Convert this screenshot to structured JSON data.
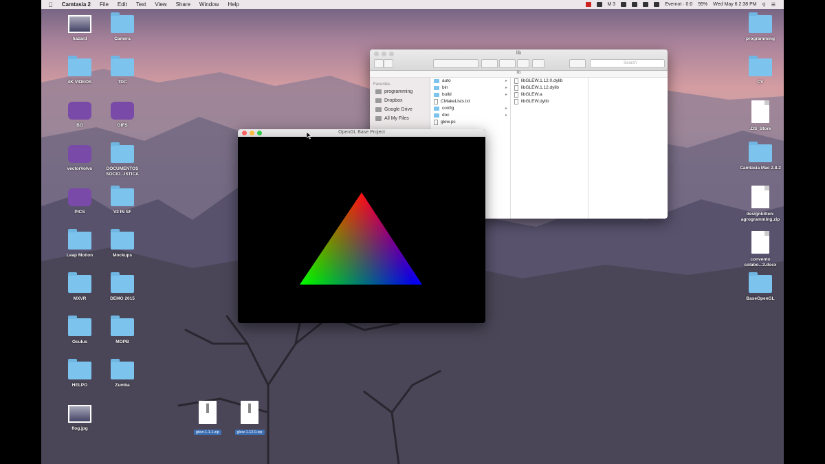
{
  "menubar": {
    "app": "Camtasia 2",
    "items": [
      "File",
      "Edit",
      "Text",
      "View",
      "Share",
      "Window",
      "Help"
    ],
    "status": {
      "m": "M 3",
      "user": "Evernot · 0:0",
      "battery": "95%",
      "clock": "Wed May 6  2:38 PM"
    }
  },
  "desktop_left": [
    {
      "label": "hazard",
      "kind": "image"
    },
    {
      "label": "Camera",
      "kind": "folder"
    },
    {
      "label": "4K VIDEOS",
      "kind": "folder"
    },
    {
      "label": "TDC",
      "kind": "folder"
    },
    {
      "label": "BG",
      "kind": "app"
    },
    {
      "label": "GIFS",
      "kind": "app"
    },
    {
      "label": "vectorVolvo",
      "kind": "app"
    },
    {
      "label": "DOCUMENTOS SOCIO...ISTICA",
      "kind": "folder"
    },
    {
      "label": "PICS",
      "kind": "app"
    },
    {
      "label": "V3 IN SF",
      "kind": "folder"
    },
    {
      "label": "Leap Motion",
      "kind": "folder"
    },
    {
      "label": "Mockups",
      "kind": "folder"
    },
    {
      "label": "MXVR",
      "kind": "folder"
    },
    {
      "label": "DEMO 2015",
      "kind": "folder"
    },
    {
      "label": "Oculus",
      "kind": "folder"
    },
    {
      "label": "MOPB",
      "kind": "folder"
    },
    {
      "label": "HELPO",
      "kind": "folder"
    },
    {
      "label": "Zumba",
      "kind": "folder"
    },
    {
      "label": "flog.jpg",
      "kind": "image"
    }
  ],
  "desktop_right": [
    {
      "label": "programming",
      "kind": "folder"
    },
    {
      "label": "CV",
      "kind": "folder"
    },
    {
      "label": ".DS_Store",
      "kind": "doc"
    },
    {
      "label": "Camtasia Mac 2.8.2",
      "kind": "folder"
    },
    {
      "label": "designkitten-agrogramming.zip",
      "kind": "zip"
    },
    {
      "label": "convento colabo...3.docx",
      "kind": "doc"
    },
    {
      "label": "BaseOpenGL",
      "kind": "folder"
    }
  ],
  "desktop_bottom": [
    {
      "label": "glew-1.1.1.zip"
    },
    {
      "label": "glew-1.12.0.zip"
    }
  ],
  "finder": {
    "title": "lib",
    "path": "lib",
    "search_placeholder": "Search",
    "sidebar_header": "Favorites",
    "sidebar_items": [
      "programming",
      "Dropbox",
      "Google Drive",
      "All My Files"
    ],
    "col1": [
      "auto",
      "bin",
      "build",
      "CMakeLists.txt",
      "config",
      "doc",
      "glew.pc"
    ],
    "col2": [
      "libGLEW.1.12.0.dylib",
      "libGLEW.1.12.dylib",
      "libGLEW.a",
      "libGLEW.dylib"
    ]
  },
  "gl_window": {
    "title": "OpenGL Base Project",
    "colors": {
      "top": "#ff0000",
      "left": "#00ff00",
      "right": "#0000ff"
    }
  }
}
